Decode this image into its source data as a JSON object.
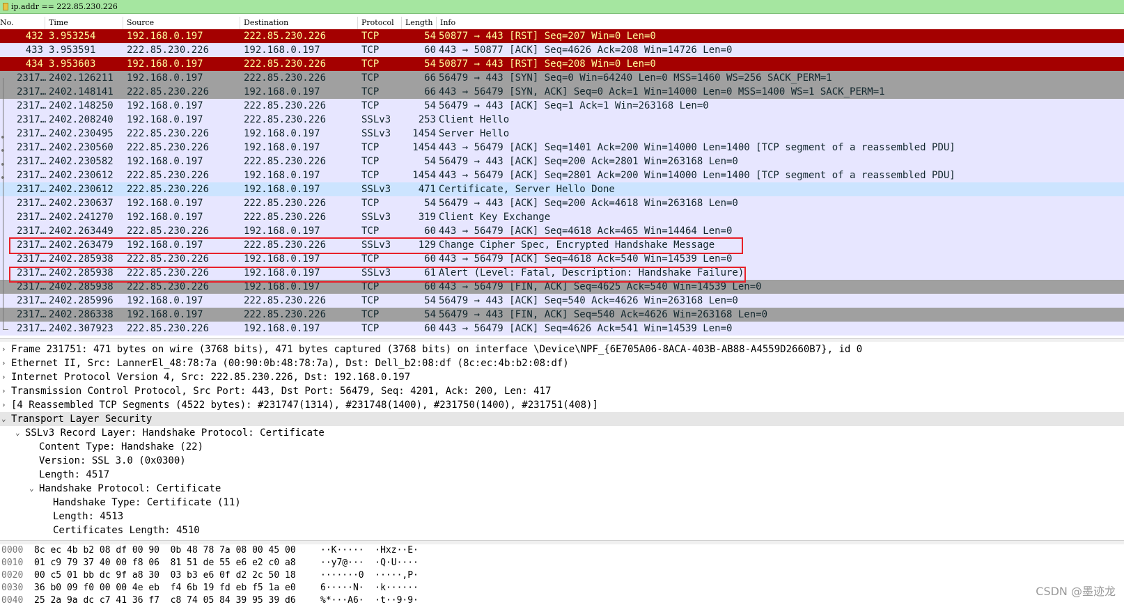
{
  "filter": {
    "text": "ip.addr == 222.85.230.226"
  },
  "columns": [
    "No.",
    "Time",
    "Source",
    "Destination",
    "Protocol",
    "Length",
    "Info"
  ],
  "colors": {
    "rst_bg": "#a40000",
    "rst_fg": "#fffc9c",
    "light_bg": "#e7e6ff",
    "gray_bg": "#a0a0a0",
    "selected_bg": "#cce4ff",
    "highlight_box": "#e8202a",
    "filter_bg": "#a5e6a0"
  },
  "packets": [
    {
      "no": "432",
      "time": "3.953254",
      "src": "192.168.0.197",
      "dst": "222.85.230.226",
      "proto": "TCP",
      "len": "54",
      "info": "50877 → 443 [RST] Seq=207 Win=0 Len=0",
      "style": "rst"
    },
    {
      "no": "433",
      "time": "3.953591",
      "src": "222.85.230.226",
      "dst": "192.168.0.197",
      "proto": "TCP",
      "len": "60",
      "info": "443 → 50877 [ACK] Seq=4626 Ack=208 Win=14726 Len=0",
      "style": "light"
    },
    {
      "no": "434",
      "time": "3.953603",
      "src": "192.168.0.197",
      "dst": "222.85.230.226",
      "proto": "TCP",
      "len": "54",
      "info": "50877 → 443 [RST] Seq=208 Win=0 Len=0",
      "style": "rst"
    },
    {
      "no": "2317…",
      "time": "2402.126211",
      "src": "192.168.0.197",
      "dst": "222.85.230.226",
      "proto": "TCP",
      "len": "66",
      "info": "56479 → 443 [SYN] Seq=0 Win=64240 Len=0 MSS=1460 WS=256 SACK_PERM=1",
      "style": "gray"
    },
    {
      "no": "2317…",
      "time": "2402.148141",
      "src": "222.85.230.226",
      "dst": "192.168.0.197",
      "proto": "TCP",
      "len": "66",
      "info": "443 → 56479 [SYN, ACK] Seq=0 Ack=1 Win=14000 Len=0 MSS=1400 WS=1 SACK_PERM=1",
      "style": "gray"
    },
    {
      "no": "2317…",
      "time": "2402.148250",
      "src": "192.168.0.197",
      "dst": "222.85.230.226",
      "proto": "TCP",
      "len": "54",
      "info": "56479 → 443 [ACK] Seq=1 Ack=1 Win=263168 Len=0",
      "style": "light"
    },
    {
      "no": "2317…",
      "time": "2402.208240",
      "src": "192.168.0.197",
      "dst": "222.85.230.226",
      "proto": "SSLv3",
      "len": "253",
      "info": "Client Hello",
      "style": "light"
    },
    {
      "no": "2317…",
      "time": "2402.230495",
      "src": "222.85.230.226",
      "dst": "192.168.0.197",
      "proto": "SSLv3",
      "len": "1454",
      "info": "Server Hello",
      "style": "light"
    },
    {
      "no": "2317…",
      "time": "2402.230560",
      "src": "222.85.230.226",
      "dst": "192.168.0.197",
      "proto": "TCP",
      "len": "1454",
      "info": "443 → 56479 [ACK] Seq=1401 Ack=200 Win=14000 Len=1400 [TCP segment of a reassembled PDU]",
      "style": "light"
    },
    {
      "no": "2317…",
      "time": "2402.230582",
      "src": "192.168.0.197",
      "dst": "222.85.230.226",
      "proto": "TCP",
      "len": "54",
      "info": "56479 → 443 [ACK] Seq=200 Ack=2801 Win=263168 Len=0",
      "style": "light"
    },
    {
      "no": "2317…",
      "time": "2402.230612",
      "src": "222.85.230.226",
      "dst": "192.168.0.197",
      "proto": "TCP",
      "len": "1454",
      "info": "443 → 56479 [ACK] Seq=2801 Ack=200 Win=14000 Len=1400 [TCP segment of a reassembled PDU]",
      "style": "light"
    },
    {
      "no": "2317…",
      "time": "2402.230612",
      "src": "222.85.230.226",
      "dst": "192.168.0.197",
      "proto": "SSLv3",
      "len": "471",
      "info": "Certificate, Server Hello Done",
      "style": "sel"
    },
    {
      "no": "2317…",
      "time": "2402.230637",
      "src": "192.168.0.197",
      "dst": "222.85.230.226",
      "proto": "TCP",
      "len": "54",
      "info": "56479 → 443 [ACK] Seq=200 Ack=4618 Win=263168 Len=0",
      "style": "light"
    },
    {
      "no": "2317…",
      "time": "2402.241270",
      "src": "192.168.0.197",
      "dst": "222.85.230.226",
      "proto": "SSLv3",
      "len": "319",
      "info": "Client Key Exchange",
      "style": "light"
    },
    {
      "no": "2317…",
      "time": "2402.263449",
      "src": "222.85.230.226",
      "dst": "192.168.0.197",
      "proto": "TCP",
      "len": "60",
      "info": "443 → 56479 [ACK] Seq=4618 Ack=465 Win=14464 Len=0",
      "style": "light"
    },
    {
      "no": "2317…",
      "time": "2402.263479",
      "src": "192.168.0.197",
      "dst": "222.85.230.226",
      "proto": "SSLv3",
      "len": "129",
      "info": "Change Cipher Spec, Encrypted Handshake Message",
      "style": "light"
    },
    {
      "no": "2317…",
      "time": "2402.285938",
      "src": "222.85.230.226",
      "dst": "192.168.0.197",
      "proto": "TCP",
      "len": "60",
      "info": "443 → 56479 [ACK] Seq=4618 Ack=540 Win=14539 Len=0",
      "style": "light"
    },
    {
      "no": "2317…",
      "time": "2402.285938",
      "src": "222.85.230.226",
      "dst": "192.168.0.197",
      "proto": "SSLv3",
      "len": "61",
      "info": "Alert (Level: Fatal, Description: Handshake Failure)",
      "style": "light"
    },
    {
      "no": "2317…",
      "time": "2402.285938",
      "src": "222.85.230.226",
      "dst": "192.168.0.197",
      "proto": "TCP",
      "len": "60",
      "info": "443 → 56479 [FIN, ACK] Seq=4625 Ack=540 Win=14539 Len=0",
      "style": "gray"
    },
    {
      "no": "2317…",
      "time": "2402.285996",
      "src": "192.168.0.197",
      "dst": "222.85.230.226",
      "proto": "TCP",
      "len": "54",
      "info": "56479 → 443 [ACK] Seq=540 Ack=4626 Win=263168 Len=0",
      "style": "light"
    },
    {
      "no": "2317…",
      "time": "2402.286338",
      "src": "192.168.0.197",
      "dst": "222.85.230.226",
      "proto": "TCP",
      "len": "54",
      "info": "56479 → 443 [FIN, ACK] Seq=540 Ack=4626 Win=263168 Len=0",
      "style": "gray"
    },
    {
      "no": "2317…",
      "time": "2402.307923",
      "src": "222.85.230.226",
      "dst": "192.168.0.197",
      "proto": "TCP",
      "len": "60",
      "info": "443 → 56479 [ACK] Seq=4626 Ack=541 Win=14539 Len=0",
      "style": "light"
    }
  ],
  "details": [
    {
      "text": "Frame 231751: 471 bytes on wire (3768 bits), 471 bytes captured (3768 bits) on interface \\Device\\NPF_{6E705A06-8ACA-403B-AB88-A4559D2660B7}, id 0",
      "level": 0,
      "arrow": "›"
    },
    {
      "text": "Ethernet II, Src: LannerEl_48:78:7a (00:90:0b:48:78:7a), Dst: Dell_b2:08:df (8c:ec:4b:b2:08:df)",
      "level": 0,
      "arrow": "›"
    },
    {
      "text": "Internet Protocol Version 4, Src: 222.85.230.226, Dst: 192.168.0.197",
      "level": 0,
      "arrow": "›"
    },
    {
      "text": "Transmission Control Protocol, Src Port: 443, Dst Port: 56479, Seq: 4201, Ack: 200, Len: 417",
      "level": 0,
      "arrow": "›"
    },
    {
      "text": "[4 Reassembled TCP Segments (4522 bytes): #231747(1314), #231748(1400), #231750(1400), #231751(408)]",
      "level": 0,
      "arrow": "›"
    },
    {
      "text": "Transport Layer Security",
      "level": 0,
      "arrow": "⌄",
      "selected": true
    },
    {
      "text": "SSLv3 Record Layer: Handshake Protocol: Certificate",
      "level": 1,
      "arrow": "⌄"
    },
    {
      "text": "Content Type: Handshake (22)",
      "level": 2,
      "arrow": ""
    },
    {
      "text": "Version: SSL 3.0 (0x0300)",
      "level": 2,
      "arrow": ""
    },
    {
      "text": "Length: 4517",
      "level": 2,
      "arrow": ""
    },
    {
      "text": "Handshake Protocol: Certificate",
      "level": 2,
      "arrow": "⌄"
    },
    {
      "text": "Handshake Type: Certificate (11)",
      "level": 3,
      "arrow": ""
    },
    {
      "text": "Length: 4513",
      "level": 3,
      "arrow": ""
    },
    {
      "text": "Certificates Length: 4510",
      "level": 3,
      "arrow": ""
    }
  ],
  "hex": [
    {
      "offset": "0000",
      "bytes": "8c ec 4b b2 08 df 00 90  0b 48 78 7a 08 00 45 00",
      "ascii": "··K·····  ·Hxz··E·"
    },
    {
      "offset": "0010",
      "bytes": "01 c9 79 37 40 00 f8 06  81 51 de 55 e6 e2 c0 a8",
      "ascii": "··y7@···  ·Q·U····"
    },
    {
      "offset": "0020",
      "bytes": "00 c5 01 bb dc 9f a8 30  03 b3 e6 0f d2 2c 50 18",
      "ascii": "·······0  ·····,P·"
    },
    {
      "offset": "0030",
      "bytes": "36 b0 09 f0 00 00 4e eb  f4 6b 19 fd eb f5 1a e0",
      "ascii": "6·····N·  ·k······"
    },
    {
      "offset": "0040",
      "bytes": "25 2a 9a dc c7 41 36 f7  c8 74 05 84 39 95 39 d6",
      "ascii": "%*···A6·  ·t··9·9·"
    }
  ],
  "watermark": "CSDN @墨迹龙"
}
